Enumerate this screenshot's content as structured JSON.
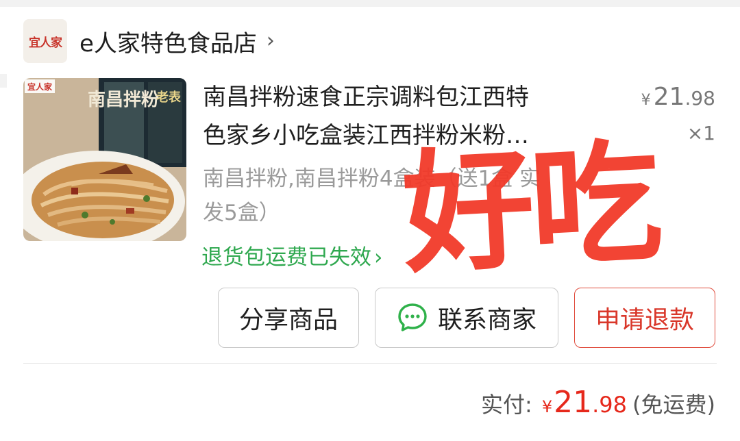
{
  "shop": {
    "logo_text": "宜人家",
    "name": "e人家特色食品店",
    "chevron": "›"
  },
  "product": {
    "title_line1": "南昌拌粉速食正宗调料包江西特",
    "title_line2": "色家乡小吃盒装江西拌粉米粉…",
    "spec_line1": "南昌拌粉,南昌拌粉4盒装（送1盒 实",
    "spec_line2": "发5盒）",
    "unit_price": {
      "yen": "¥",
      "int": "21",
      "dec": ".98"
    },
    "quantity": "×1",
    "image_label": "南昌拌粉",
    "image_logo": "宜人家",
    "image_corner": "老表"
  },
  "return_note": {
    "text": "退货包运费已失效",
    "chevron": "›"
  },
  "watermark": "好吃",
  "actions": {
    "share": "分享商品",
    "contact": "联系商家",
    "refund": "申请退款"
  },
  "payment": {
    "label": "实付:",
    "yen": "¥",
    "int": "21",
    "dec": ".98",
    "note": "(免运费)"
  },
  "colors": {
    "accent_red": "#e6281b",
    "return_green": "#2fa84f",
    "watermark_red": "#f23a2a",
    "wechat_green": "#2fb14a"
  },
  "icons": {
    "chat": "chat-bubble-icon",
    "chevron": "chevron-right-icon"
  }
}
